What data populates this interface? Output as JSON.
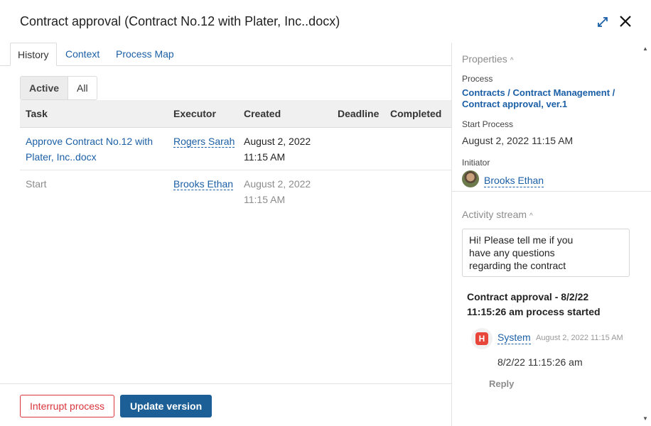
{
  "window": {
    "title": "Contract approval (Contract No.12 with Plater, Inc..docx)"
  },
  "tabs": [
    {
      "label": "History",
      "active": true
    },
    {
      "label": "Context"
    },
    {
      "label": "Process Map"
    }
  ],
  "filter": {
    "options": [
      "Active",
      "All"
    ],
    "selected": "Active"
  },
  "table": {
    "headers": [
      "Task",
      "Executor",
      "Created",
      "Deadline",
      "Completed"
    ],
    "rows": [
      {
        "task_line1": "Approve Contract No.12 with",
        "task_line2": "Plater, Inc..docx",
        "executor": "Rogers Sarah",
        "created_line1": "August 2, 2022",
        "created_line2": "11:15 AM",
        "deadline": "",
        "completed": ""
      },
      {
        "task_line1": "Start",
        "task_line2": "",
        "executor": "Brooks Ethan",
        "created_line1": "August 2, 2022",
        "created_line2": "11:15 AM",
        "deadline": "",
        "completed": ""
      }
    ]
  },
  "footer": {
    "interrupt_label": "Interrupt process",
    "update_label": "Update version"
  },
  "properties": {
    "title": "Properties",
    "process_label": "Process",
    "process_value_line1": "Contracts / Contract Management /",
    "process_value_line2": "Contract approval, ver.1",
    "start_label": "Start Process",
    "start_value": "August 2, 2022 11:15 AM",
    "initiator_label": "Initiator",
    "initiator_name": "Brooks Ethan"
  },
  "activity": {
    "title": "Activity stream",
    "comment_lines": [
      "Hi! Please tell me if you",
      "have any questions",
      "regarding the contract"
    ],
    "event_line1": "Contract approval - 8/2/22",
    "event_line2": "11:15:26 am process started",
    "author": "System",
    "time": "August 2, 2022 11:15 AM",
    "message": "8/2/22 11:15:26 am",
    "reply_label": "Reply"
  },
  "colors": {
    "link": "#1b5fa6",
    "primary_button": "#1c5f96",
    "danger": "#d9343a",
    "system_icon": "#e8463a"
  },
  "icons": [
    "expand-icon",
    "close-icon",
    "caret-up-icon",
    "system-icon",
    "scroll-up-icon",
    "scroll-down-icon"
  ]
}
